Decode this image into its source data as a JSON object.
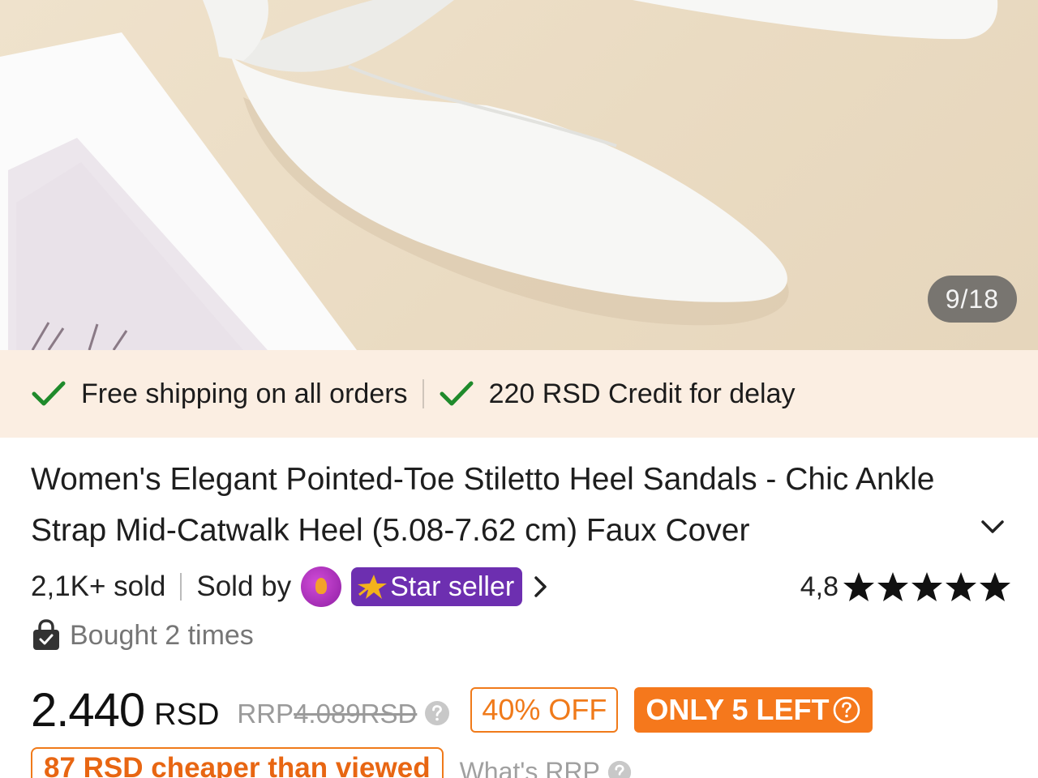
{
  "gallery": {
    "counter": "9/18"
  },
  "guarantees": [
    {
      "icon": "checkmark-icon",
      "label": "Free shipping on all orders"
    },
    {
      "icon": "checkmark-icon",
      "label": "220 RSD Credit for delay"
    }
  ],
  "product": {
    "title": "Women's Elegant Pointed-Toe Stiletto Heel Sandals - Chic Ankle Strap Mid-Catwalk Heel (5.08-7.62 cm) Faux Cover"
  },
  "meta": {
    "sold": "2,1K+ sold",
    "sold_by": "Sold by",
    "star_seller": "Star seller",
    "rating": "4,8",
    "stars": 5
  },
  "bought": {
    "text": "Bought 2 times"
  },
  "price": {
    "value": "2.440",
    "currency": "RSD",
    "rrp_label": "RRP",
    "rrp_value": "4.089RSD",
    "discount": "40% OFF",
    "stock": "ONLY 5 LEFT"
  },
  "promo": {
    "cheaper": "87 RSD cheaper than viewed",
    "whats_rrp": "What's RRP"
  },
  "colors": {
    "accent": "#f5781c",
    "check": "#1f8a2b",
    "star_seller_bg": "#6d2fb0",
    "guarantee_bg": "#fbeee2"
  }
}
